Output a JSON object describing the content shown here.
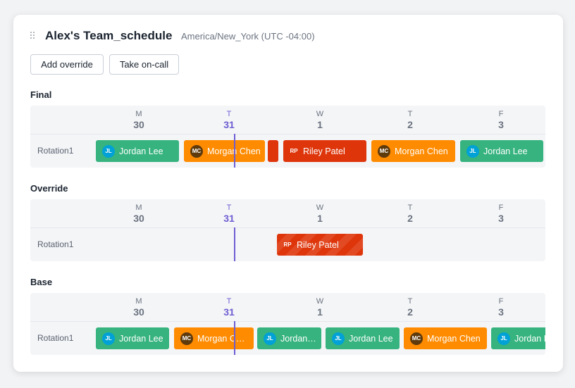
{
  "header": {
    "title": "Alex's Team_schedule",
    "timezone": "America/New_York (UTC -04:00)"
  },
  "toolbar": {
    "add_override": "Add override",
    "take_oncall": "Take on-call"
  },
  "days": [
    {
      "dow": "M",
      "date": "30",
      "today": false
    },
    {
      "dow": "T",
      "date": "31",
      "today": true
    },
    {
      "dow": "W",
      "date": "1",
      "today": false
    },
    {
      "dow": "T",
      "date": "2",
      "today": false
    },
    {
      "dow": "F",
      "date": "3",
      "today": false
    }
  ],
  "sections": {
    "final": {
      "label": "Final",
      "row_label": "Rotation1",
      "blocks": [
        {
          "initials": "JL",
          "name": "Jordan Lee"
        },
        {
          "initials": "MC",
          "name": "Morgan Chen"
        },
        {
          "initials": "",
          "name": ""
        },
        {
          "initials": "RP",
          "name": "Riley Patel"
        },
        {
          "initials": "MC",
          "name": "Morgan Chen"
        },
        {
          "initials": "JL",
          "name": "Jordan Lee"
        }
      ]
    },
    "override": {
      "label": "Override",
      "row_label": "Rotation1",
      "blocks": [
        {
          "initials": "RP",
          "name": "Riley Patel"
        }
      ]
    },
    "base": {
      "label": "Base",
      "row_label": "Rotation1",
      "blocks": [
        {
          "initials": "JL",
          "name": "Jordan Lee"
        },
        {
          "initials": "MC",
          "name": "Morgan Chen"
        },
        {
          "initials": "JL",
          "name": "Jordan Lee"
        },
        {
          "initials": "JL",
          "name": "Jordan Lee"
        },
        {
          "initials": "MC",
          "name": "Morgan Chen"
        },
        {
          "initials": "JL",
          "name": "Jordan Lee"
        }
      ]
    }
  },
  "colors": {
    "accent": "#6c5dd3",
    "jordan": "#36b37e",
    "morgan": "#ff8b00",
    "riley": "#de350b",
    "jordan_alt": "#00a3a3"
  }
}
